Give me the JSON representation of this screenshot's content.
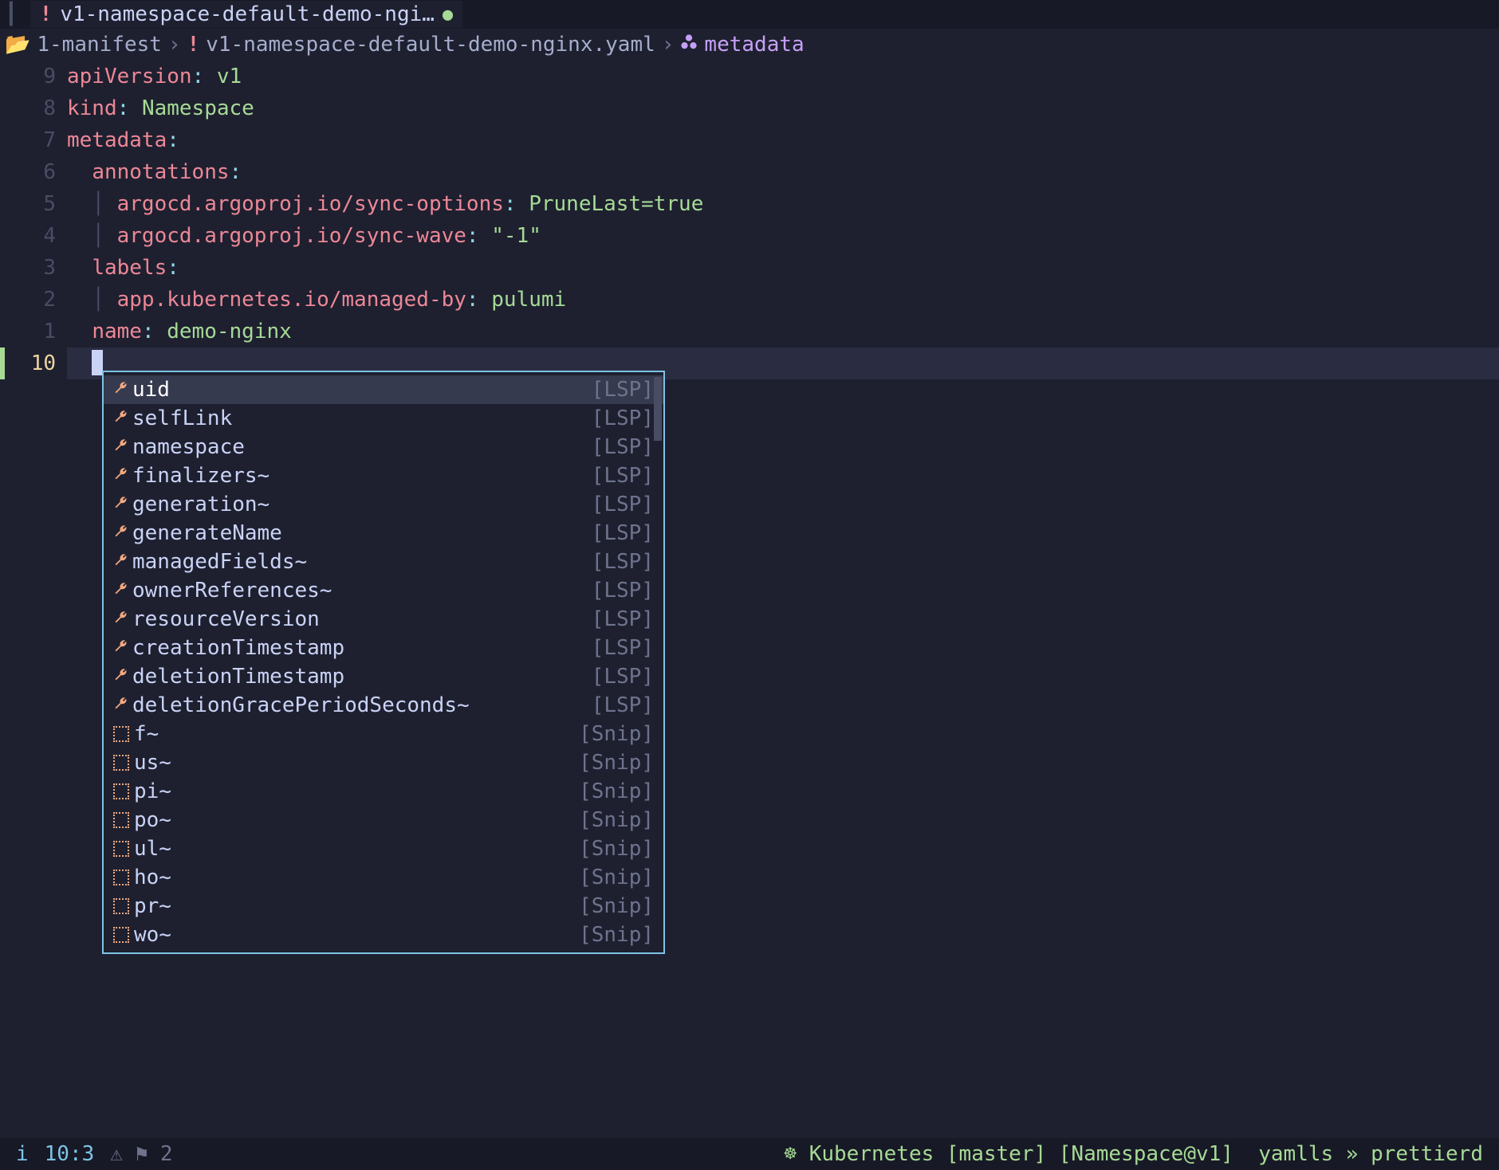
{
  "tab": {
    "filename": "v1-namespace-default-demo-ngi…",
    "modified_dot": "●"
  },
  "breadcrumb": {
    "dir": "1-manifest",
    "file": "v1-namespace-default-demo-nginx.yaml",
    "symbol": "metadata"
  },
  "gutter": [
    "9",
    "8",
    "7",
    "6",
    "5",
    "4",
    "3",
    "2",
    "1",
    "10"
  ],
  "code": {
    "l1_key": "apiVersion",
    "l1_val": "v1",
    "l2_key": "kind",
    "l2_val": "Namespace",
    "l3_key": "metadata",
    "l4_key": "annotations",
    "l5_key": "argocd.argoproj.io/sync-options",
    "l5_val": "PruneLast=true",
    "l6_key": "argocd.argoproj.io/sync-wave",
    "l6_val": "\"-1\"",
    "l7_key": "labels",
    "l8_key": "app.kubernetes.io/managed-by",
    "l8_val": "pulumi",
    "l9_key": "name",
    "l9_val": "demo-nginx"
  },
  "completions": [
    {
      "icon": "wrench",
      "label": "uid",
      "src": "[LSP]"
    },
    {
      "icon": "wrench",
      "label": "selfLink",
      "src": "[LSP]"
    },
    {
      "icon": "wrench",
      "label": "namespace",
      "src": "[LSP]"
    },
    {
      "icon": "wrench",
      "label": "finalizers~",
      "src": "[LSP]"
    },
    {
      "icon": "wrench",
      "label": "generation~",
      "src": "[LSP]"
    },
    {
      "icon": "wrench",
      "label": "generateName",
      "src": "[LSP]"
    },
    {
      "icon": "wrench",
      "label": "managedFields~",
      "src": "[LSP]"
    },
    {
      "icon": "wrench",
      "label": "ownerReferences~",
      "src": "[LSP]"
    },
    {
      "icon": "wrench",
      "label": "resourceVersion",
      "src": "[LSP]"
    },
    {
      "icon": "wrench",
      "label": "creationTimestamp",
      "src": "[LSP]"
    },
    {
      "icon": "wrench",
      "label": "deletionTimestamp",
      "src": "[LSP]"
    },
    {
      "icon": "wrench",
      "label": "deletionGracePeriodSeconds~",
      "src": "[LSP]"
    },
    {
      "icon": "snip",
      "label": "f~",
      "src": "[Snip]"
    },
    {
      "icon": "snip",
      "label": "us~",
      "src": "[Snip]"
    },
    {
      "icon": "snip",
      "label": "pi~",
      "src": "[Snip]"
    },
    {
      "icon": "snip",
      "label": "po~",
      "src": "[Snip]"
    },
    {
      "icon": "snip",
      "label": "ul~",
      "src": "[Snip]"
    },
    {
      "icon": "snip",
      "label": "ho~",
      "src": "[Snip]"
    },
    {
      "icon": "snip",
      "label": "pr~",
      "src": "[Snip]"
    },
    {
      "icon": "snip",
      "label": "wo~",
      "src": "[Snip]"
    }
  ],
  "status": {
    "mode": "i",
    "pos": "10:3",
    "diag": "⚠   ⚑ 2",
    "right": "☸ Kubernetes [master] [Namespace@v1]  yamlls » prettierd"
  }
}
